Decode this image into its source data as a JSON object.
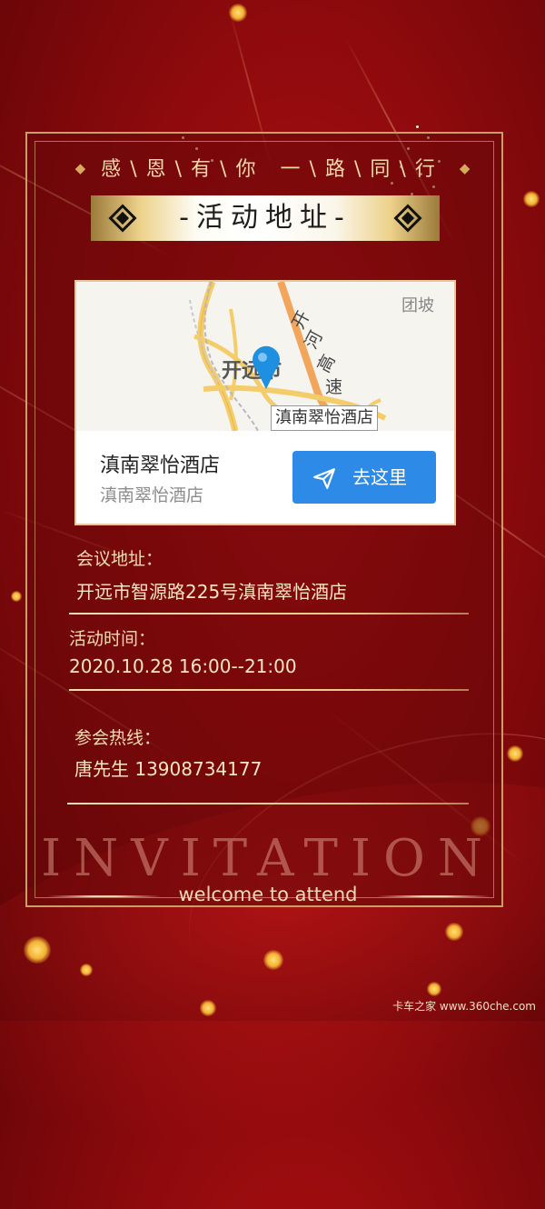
{
  "header": {
    "tagline": [
      "感",
      "恩",
      "有",
      "你",
      "一",
      "路",
      "同",
      "行"
    ],
    "title": "-活动地址-"
  },
  "map": {
    "labels": {
      "town": "团坡",
      "city": "开远市",
      "highway": [
        "开",
        "河",
        "高",
        "速"
      ],
      "pin_label": "滇南翠怡酒店"
    },
    "hotel_name": "滇南翠怡酒店",
    "hotel_address": "滇南翠怡酒店",
    "go_button": "去这里",
    "colors": {
      "button": "#2d8ae6",
      "pin": "#1f8fe0",
      "road": "#f4cd6a"
    }
  },
  "details": {
    "meeting_address": {
      "label": "会议地址：",
      "value": "开远市智源路225号滇南翠怡酒店"
    },
    "activity_time": {
      "label": "活动时间：",
      "value": "2020.10.28  16:00--21:00"
    },
    "hotline": {
      "label": "参会热线：",
      "value": "唐先生  13908734177"
    }
  },
  "footer": {
    "invitation": "INVITATION",
    "welcome": "welcome to attend"
  },
  "watermark": "卡车之家 www.360che.com",
  "colors": {
    "background": "#8e0a0d",
    "gold": "#c9a063",
    "text": "#f7e6bf"
  }
}
